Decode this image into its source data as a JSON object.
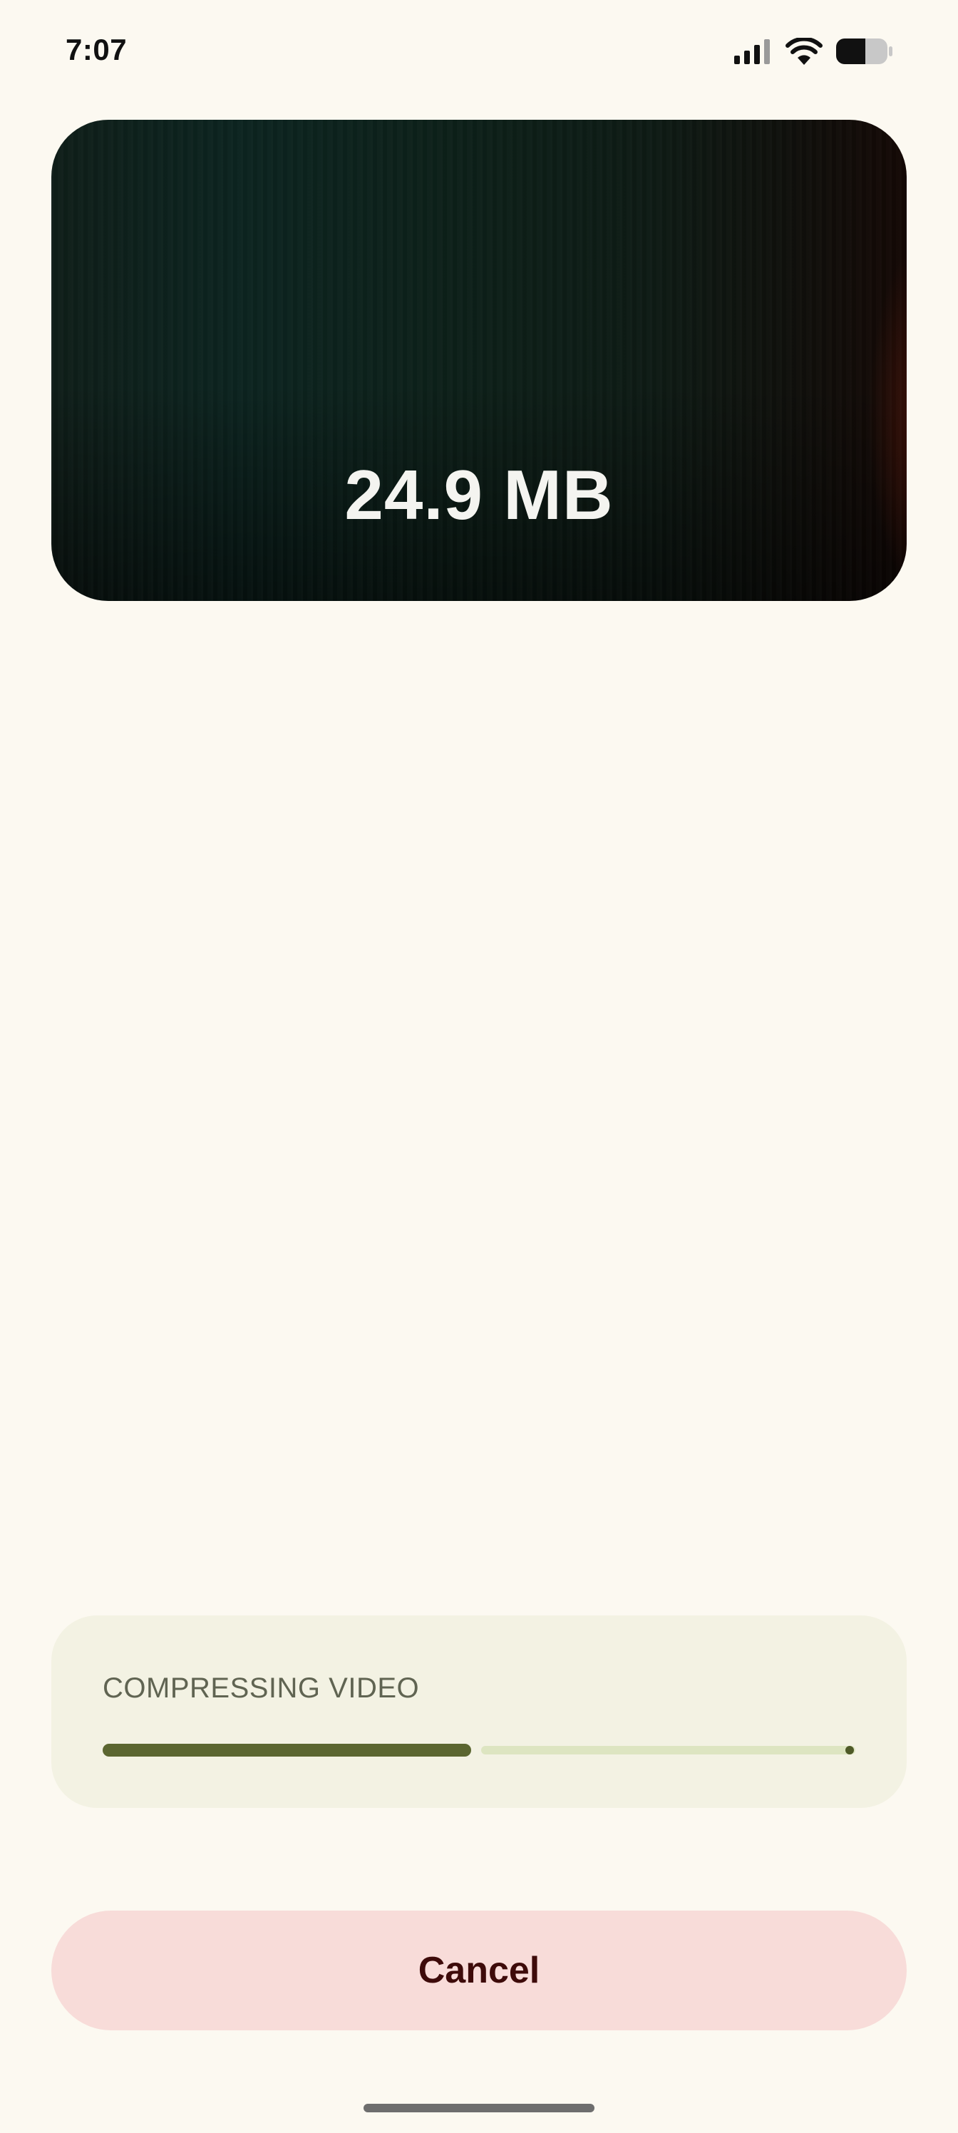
{
  "status_bar": {
    "time": "7:07",
    "icons": [
      "signal-icon",
      "wifi-icon",
      "battery-icon"
    ]
  },
  "video_preview": {
    "file_size": "24.9 MB"
  },
  "compression": {
    "label": "COMPRESSING VIDEO",
    "progress_fraction": 0.49
  },
  "actions": {
    "cancel_label": "Cancel"
  },
  "colors": {
    "background": "#fcf9f1",
    "progress_fill": "#5b6630",
    "progress_track": "#dde5c1",
    "card_background": "#f3f2e3",
    "cancel_background": "#f8dcd9",
    "cancel_text": "#3e0b0a"
  }
}
